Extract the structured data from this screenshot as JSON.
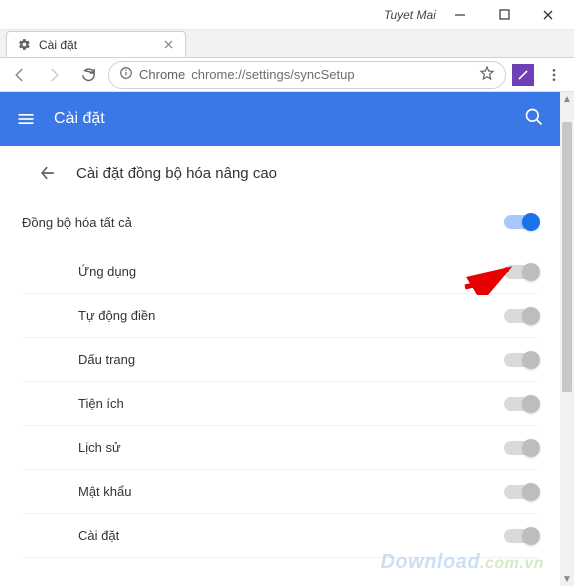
{
  "window": {
    "username": "Tuyet Mai"
  },
  "tab": {
    "title": "Cài đặt"
  },
  "addressbar": {
    "secure_label": "Chrome",
    "url": "chrome://settings/syncSetup"
  },
  "header": {
    "title": "Cài đặt"
  },
  "subheader": {
    "title": "Cài đặt đồng bộ hóa nâng cao"
  },
  "sync": {
    "master_label": "Đồng bộ hóa tất cả",
    "master_on": true,
    "items": [
      {
        "label": "Ứng dụng"
      },
      {
        "label": "Tự động điền"
      },
      {
        "label": "Dấu trang"
      },
      {
        "label": "Tiện ích"
      },
      {
        "label": "Lịch sử"
      },
      {
        "label": "Mật khẩu"
      },
      {
        "label": "Cài đặt"
      }
    ]
  },
  "watermark": {
    "main": "Download",
    "suffix": ".com.vn"
  }
}
